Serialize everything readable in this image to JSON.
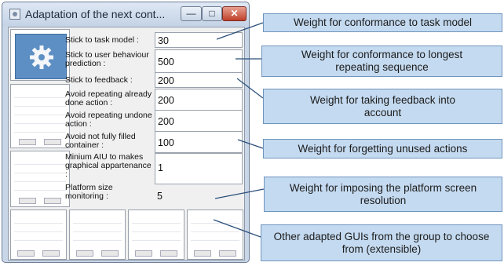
{
  "window": {
    "title": "Adaptation of the next cont...",
    "controls": {
      "minimize": "—",
      "maximize": "□",
      "close": "✕"
    }
  },
  "fields": [
    {
      "label": "Stick to task model :",
      "value": "30"
    },
    {
      "label": "Stick to user behaviour prediction :",
      "value": "500"
    },
    {
      "label": "Stick to feedback :",
      "value": "200"
    },
    {
      "label": "Avoid repeating already done action :",
      "value": "200"
    },
    {
      "label": "Avoid repeating undone action :",
      "value": "200"
    },
    {
      "label": "Avoid not fully filled container :",
      "value": "100"
    },
    {
      "label": "Minium AIU to makes graphical appartenance :",
      "value": "1"
    },
    {
      "label": "Platform size monitoring :",
      "value": "5"
    }
  ],
  "annotations": [
    {
      "text": "Weight for conformance to task model"
    },
    {
      "text": "Weight for conformance to longest repeating sequence"
    },
    {
      "text": "Weight for taking feedback into account"
    },
    {
      "text": "Weight for forgetting unused actions"
    },
    {
      "text": "Weight for imposing the platform screen resolution"
    },
    {
      "text": "Other adapted GUIs from the group to choose from (extensible)"
    }
  ],
  "icons": {
    "app": "window-app-icon",
    "gear": "gear-icon"
  },
  "colors": {
    "callout_fill": "#c4daf0",
    "callout_border": "#6f95bd",
    "gear_tile": "#5d8fc4"
  }
}
